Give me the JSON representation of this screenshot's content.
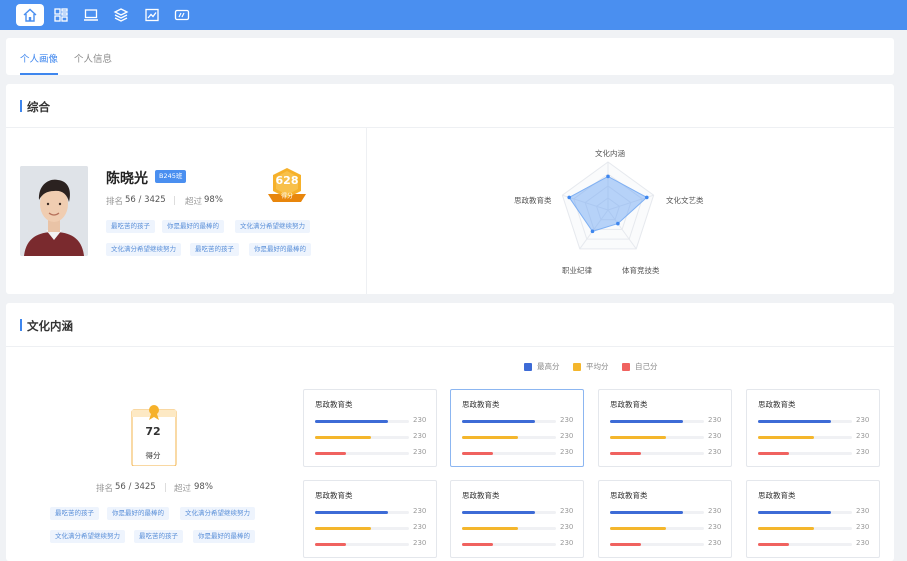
{
  "nav": {
    "icons": [
      "home-icon",
      "grid-icon",
      "laptop-icon",
      "layers-icon",
      "chart-icon",
      "card-icon"
    ],
    "active_index": 0
  },
  "tabs": [
    {
      "label": "个人画像",
      "active": true
    },
    {
      "label": "个人信息",
      "active": false
    }
  ],
  "summary": {
    "title": "综合",
    "profile": {
      "name": "陈晓光",
      "class_badge": "B245班",
      "rank_label": "排名",
      "rank_value": "56 / 3425",
      "exceed_label": "超过",
      "exceed_value": "98%",
      "score": "628",
      "score_label": "得分",
      "tags": [
        "最吃苦的孩子",
        "你是最好的最棒的",
        "文化满分希望继续努力",
        "文化满分希望继续努力",
        "最吃苦的孩子",
        "你是最好的最棒的"
      ]
    },
    "radar": {
      "axes": [
        "文化内涵",
        "文化文艺类",
        "体育竞技类",
        "职业纪律",
        "思政教育类"
      ],
      "values": [
        0.7,
        0.85,
        0.35,
        0.55,
        0.85
      ]
    }
  },
  "culture": {
    "title": "文化内涵",
    "legend": [
      {
        "label": "最高分",
        "color": "#3d6bd6"
      },
      {
        "label": "平均分",
        "color": "#f4b62c"
      },
      {
        "label": "自己分",
        "color": "#f0625f"
      }
    ],
    "score": "72",
    "score_label": "得分",
    "rank_label": "排名",
    "rank_value": "56 / 3425",
    "exceed_label": "超过",
    "exceed_value": "98%",
    "tags": [
      "最吃苦的孩子",
      "你是最好的最棒的",
      "文化满分希望继续努力",
      "文化满分希望继续努力",
      "最吃苦的孩子",
      "你是最好的最棒的"
    ],
    "cards": [
      {
        "title": "思政教育类",
        "max": "230",
        "avg": "230",
        "self": "230",
        "max_fill": 0.78,
        "avg_fill": 0.6,
        "self_fill": 0.33
      },
      {
        "title": "思政教育类",
        "max": "230",
        "avg": "230",
        "self": "230",
        "max_fill": 0.78,
        "avg_fill": 0.6,
        "self_fill": 0.33
      },
      {
        "title": "思政教育类",
        "max": "230",
        "avg": "230",
        "self": "230",
        "max_fill": 0.78,
        "avg_fill": 0.6,
        "self_fill": 0.33
      },
      {
        "title": "思政教育类",
        "max": "230",
        "avg": "230",
        "self": "230",
        "max_fill": 0.78,
        "avg_fill": 0.6,
        "self_fill": 0.33
      },
      {
        "title": "思政教育类",
        "max": "230",
        "avg": "230",
        "self": "230",
        "max_fill": 0.78,
        "avg_fill": 0.6,
        "self_fill": 0.33
      },
      {
        "title": "思政教育类",
        "max": "230",
        "avg": "230",
        "self": "230",
        "max_fill": 0.78,
        "avg_fill": 0.6,
        "self_fill": 0.33
      },
      {
        "title": "思政教育类",
        "max": "230",
        "avg": "230",
        "self": "230",
        "max_fill": 0.78,
        "avg_fill": 0.6,
        "self_fill": 0.33
      },
      {
        "title": "思政教育类",
        "max": "230",
        "avg": "230",
        "self": "230",
        "max_fill": 0.78,
        "avg_fill": 0.6,
        "self_fill": 0.33
      }
    ],
    "selected_card": 1
  }
}
